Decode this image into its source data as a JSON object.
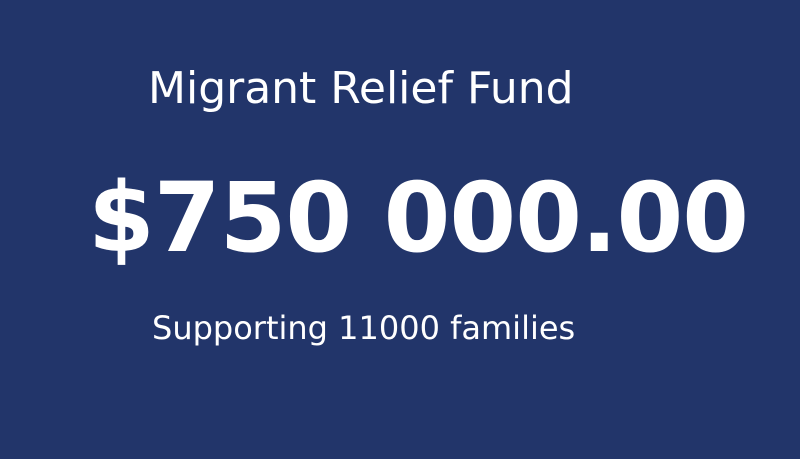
{
  "card": {
    "title": "Migrant Relief Fund",
    "amount": "$750 000.00",
    "subtitle": "Supporting 11000 families",
    "background_color": "#22356a",
    "text_color": "#ffffff"
  }
}
